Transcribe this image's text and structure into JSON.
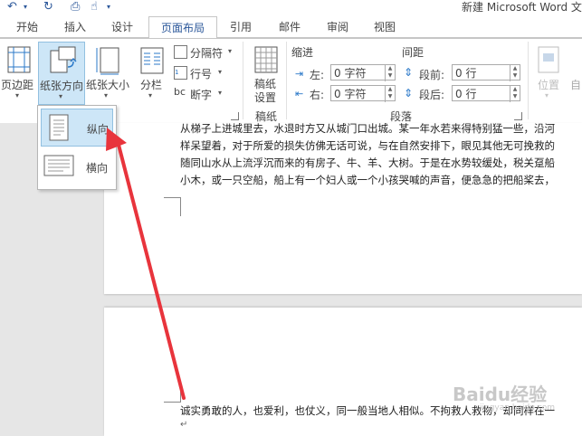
{
  "title_bar": {
    "document_title": "新建 Microsoft Word 文"
  },
  "tabs": [
    {
      "label": "开始"
    },
    {
      "label": "插入"
    },
    {
      "label": "设计"
    },
    {
      "label": "页面布局"
    },
    {
      "label": "引用"
    },
    {
      "label": "邮件"
    },
    {
      "label": "审阅"
    },
    {
      "label": "视图"
    }
  ],
  "ribbon": {
    "page_setup": {
      "margins": "页边距",
      "orientation": "纸张方向",
      "size": "纸张大小",
      "columns": "分栏",
      "breaks": "分隔符",
      "line_numbers": "行号",
      "hyphenation": "断字"
    },
    "draft": {
      "button": "稿纸\n设置",
      "button_line1": "稿纸",
      "button_line2": "设置",
      "group": "稿纸"
    },
    "paragraph": {
      "indent_title": "缩进",
      "spacing_title": "间距",
      "left_label": "左:",
      "right_label": "右:",
      "left_value": "0 字符",
      "right_value": "0 字符",
      "before_label": "段前:",
      "after_label": "段后:",
      "before_value": "0 行",
      "after_value": "0 行",
      "group": "段落"
    },
    "arrange": {
      "position": "位置",
      "wrap": "自"
    }
  },
  "orientation_menu": {
    "portrait": "纵向",
    "landscape": "横向"
  },
  "document": {
    "page1_lines": [
      "从梯子上进城里去，水退时方又从城门口出城。某一年水若来得特别猛一些，沿河",
      "样呆望着，对于所爱的损失仿佛无话可说，与在自然安排下，眼见其他无可挽救的",
      "随同山水从上流浮沉而来的有房子、牛、羊、大树。于是在水势较缓处，税关趸船",
      "小木，或一只空船，船上有一个妇人或一个小孩哭喊的声音，便急急的把船桨去，"
    ],
    "page2_line": "诚实勇敢的人，也爱利，也仗义，同一般当地人相似。不拘救人救物，却同样在一"
  },
  "watermark": {
    "text": "Baidu经验",
    "sub": "jingyan.baidu.com"
  },
  "colors": {
    "accent": "#2b579a",
    "arrow": "#e8343c",
    "selected": "#cde6f7"
  }
}
